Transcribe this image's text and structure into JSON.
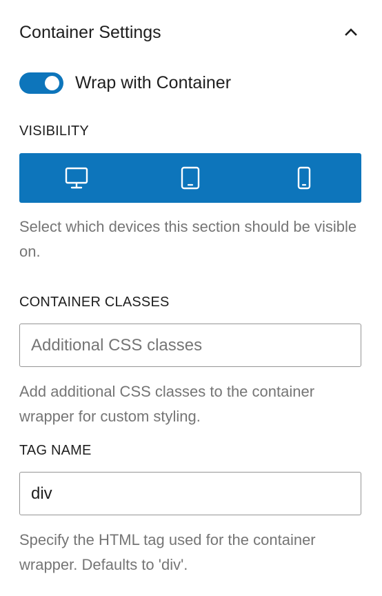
{
  "panel": {
    "title": "Container Settings",
    "collapse_icon": "chevron-up-icon"
  },
  "wrap_toggle": {
    "label": "Wrap with Container",
    "checked": true,
    "accent_color": "#0d75bb"
  },
  "visibility": {
    "label": "VISIBILITY",
    "devices": [
      {
        "name": "desktop",
        "icon": "desktop-icon",
        "active": true
      },
      {
        "name": "tablet",
        "icon": "tablet-icon",
        "active": true
      },
      {
        "name": "mobile",
        "icon": "mobile-icon",
        "active": true
      }
    ],
    "help": "Select which devices this section should be visible on."
  },
  "container_classes": {
    "label": "CONTAINER CLASSES",
    "value": "",
    "placeholder": "Additional CSS classes",
    "help": "Add additional CSS classes to the container wrapper for custom styling."
  },
  "tag_name": {
    "label": "TAG NAME",
    "value": "div",
    "placeholder": "",
    "help": "Specify the HTML tag used for the container wrapper. Defaults to 'div'."
  }
}
